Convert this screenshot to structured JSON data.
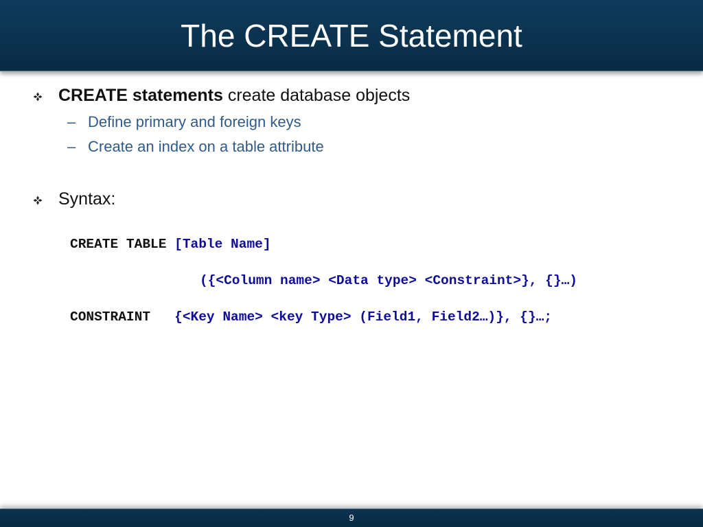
{
  "slide": {
    "title": "The CREATE Statement",
    "page_number": "9"
  },
  "bullets": [
    {
      "bold": "CREATE statements",
      "text": " create database objects",
      "icon": "diamond-bullet-icon",
      "subitems": [
        "Define primary and foreign keys",
        "Create an index on a table attribute"
      ]
    },
    {
      "bold": "",
      "text": "Syntax:",
      "icon": "diamond-bullet-icon",
      "subitems": []
    }
  ],
  "code": {
    "line1_keyword": "CREATE TABLE ",
    "line1_value": "[Table Name]",
    "line2_value": "({<Column name> <Data type> <Constraint>}, {}…)",
    "line3_keyword": "CONSTRAINT   ",
    "line3_value": "{<Key Name> <key Type> (Field1, Field2…)}, {}…;"
  },
  "colors": {
    "title_bar": "#0b3350",
    "sub_bullet_text": "#2f5b8a",
    "code_value": "#0d0d99"
  }
}
